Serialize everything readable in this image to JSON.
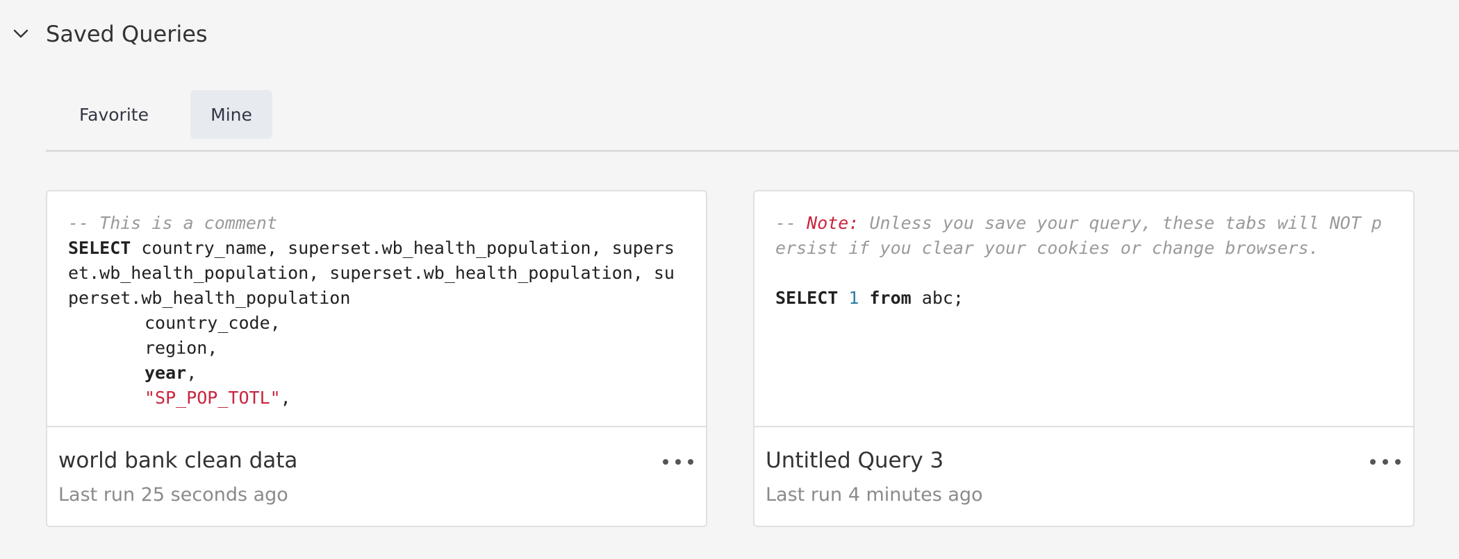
{
  "section": {
    "title": "Saved Queries"
  },
  "tabs": [
    {
      "label": "Favorite",
      "active": false
    },
    {
      "label": "Mine",
      "active": true
    }
  ],
  "cards": [
    {
      "sql": {
        "comment": "-- This is a comment",
        "select_kw": "SELECT",
        "select_rest": " country_name, superset.wb_health_population, superset.wb_health_population, superset.wb_health_population, superset.wb_health_population",
        "col1": "country_code,",
        "col2": "region,",
        "col3_kw": "year",
        "col3_rest": ",",
        "col4_str": "\"SP_POP_TOTL\"",
        "col4_rest": ","
      },
      "title": "world bank clean data",
      "last_run": "Last run 25 seconds ago"
    },
    {
      "sql": {
        "comment_prefix": "-- ",
        "note_label": "Note:",
        "comment_rest": " Unless you save your query, these tabs will NOT persist if you clear your cookies or change browsers.",
        "select_kw": "SELECT",
        "number": "1",
        "from_kw": "from",
        "rest": " abc;"
      },
      "title": "Untitled Query 3",
      "last_run": "Last run 4 minutes ago"
    }
  ],
  "colors": {
    "background": "#f5f5f5",
    "active_tab": "#e7eaee",
    "string": "#c8243e",
    "number": "#2c7fa8",
    "comment": "#9a9a9a"
  },
  "icons": {
    "collapse": "chevron-down-icon",
    "more": "more-horizontal-icon"
  }
}
